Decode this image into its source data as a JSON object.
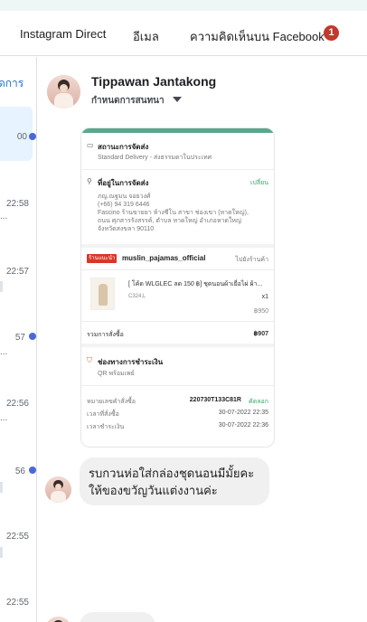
{
  "tabs": {
    "instagram": "Instagram Direct",
    "email": "อีเมล",
    "facebook_comments": "ความคิดเห็นบน Facebook",
    "facebook_badge": "1"
  },
  "left_panel": {
    "top_link": "ดการ",
    "times": [
      "00",
      "22:58",
      "22:57",
      "57",
      "22:56",
      "56",
      "22:55",
      "22:55"
    ],
    "ellipsis": "..."
  },
  "conversation": {
    "contact_name": "Tippawan Jantakong",
    "label_dropdown": "กำหนดการสนทนา"
  },
  "order_card": {
    "shipping_status_title": "สถานะการจัดส่ง",
    "shipping_status_text": "Standard Delivery - ส่งธรรมดาในประเทศ",
    "address_title": "ที่อยู่ในการจัดส่ง",
    "address_change": "เปลี่ยน",
    "address_lines": [
      "ภญ.ณฐมน จอยวงศ์",
      "(+66) 94 319 6446",
      "Fascino ร้านขายยา ห้างซีโน สาขา ช่องเขา (หาดใหญ่),",
      "ถนน ศุภสารรังสรรค์, ตำบล หาดใหญ่ อำเภอหาดใหญ่",
      "จังหวัดสงขลา 90110"
    ],
    "shop_badge": "ร้านแนะนำ",
    "shop_name": "muslin_pajamas_official",
    "shop_link": "ไปยังร้านค้า",
    "product_name": "[ โค้ด WLGLEC ลด 150 ฿] ชุดนอนผ้าเยื่อไผ่ ผ้า...",
    "product_variant": "C324,L",
    "product_qty": "x1",
    "product_price": "฿950",
    "total_label": "รวมการสั่งซื้อ",
    "total_value": "฿907",
    "payment_title": "ช่องทางการชำระเงิน",
    "payment_text": "QR พร้อมเพย์",
    "order_no_label": "หมายเลขคำสั่งซื้อ",
    "order_no": "220730T133C81R",
    "order_copy": "คัดลอก",
    "order_time_label": "เวลาที่สั่งซื้อ",
    "order_time": "30-07-2022 22:35",
    "pay_time_label": "เวลาชำระเงิน",
    "pay_time": "30-07-2022 22:36"
  },
  "message": {
    "text_line1": "รบกวนห่อใส่กล่องชุดนอนมีมั้ยคะ",
    "text_line2": "ให้ของขวัญวันแต่งงานค่ะ"
  },
  "colors": {
    "badge_red": "#c0392b",
    "link_blue": "#216fdb",
    "unread_dot": "#4a68d8",
    "card_accent": "#5aa78e",
    "shop_badge_red": "#d9352b"
  }
}
